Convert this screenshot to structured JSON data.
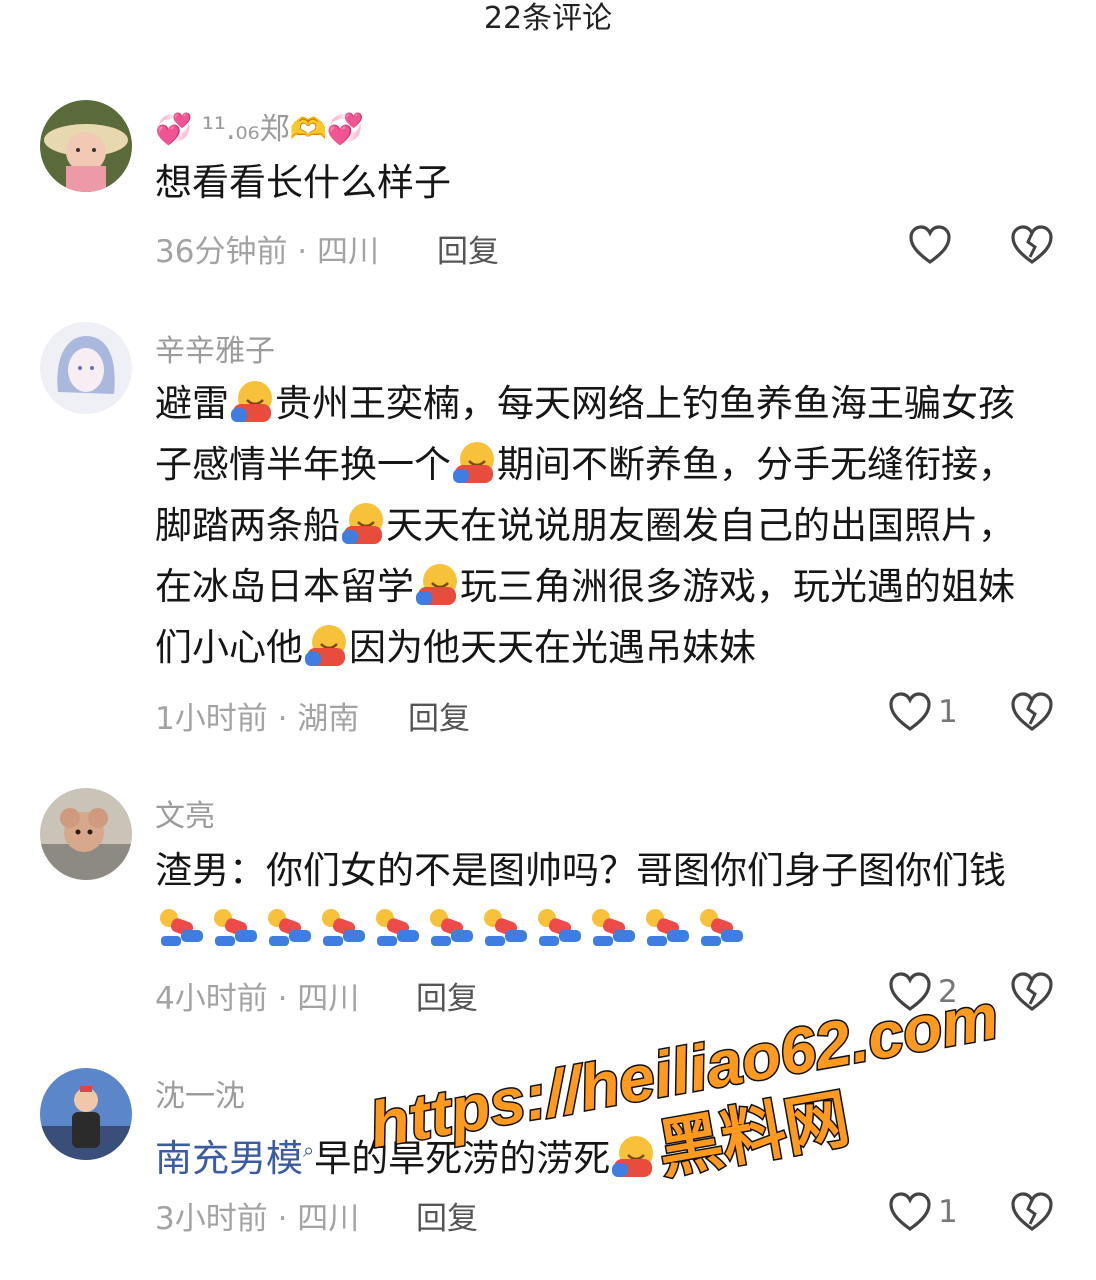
{
  "header": {
    "title": "22条评论"
  },
  "comments": [
    {
      "author": "💞 ¹¹.₀₆郑🫶💞",
      "text": "想看看长什么样子",
      "time_location": "36分钟前 · 四川",
      "reply_label": "回复",
      "like_count": ""
    },
    {
      "author": "辛辛雅子",
      "segments": [
        "避雷",
        "贵州王奕楠，每天网络上钓鱼养鱼海王骗女孩子感情半年换一个",
        "期间不断养鱼，分手无缝衔接，脚踏两条船",
        "天天在说说朋友圈发自己的出国照片，在冰岛日本留学",
        "玩三角洲很多游戏，玩光遇的姐妹们小心他",
        "因为他天天在光遇吊妹妹"
      ],
      "time_location": "1小时前 · 湖南",
      "reply_label": "回复",
      "like_count": "1"
    },
    {
      "author": "文亮",
      "text": "渣男：你们女的不是图帅吗？哥图你们身子图你们钱",
      "time_location": "4小时前 · 四川",
      "reply_label": "回复",
      "like_count": "2"
    },
    {
      "author": "沈一沈",
      "mention": "南充男模",
      "text": "早的旱死涝的涝死",
      "time_location": "3小时前 · 四川",
      "reply_label": "回复",
      "like_count": "1"
    }
  ],
  "icons": {
    "like": "heart-outline-icon",
    "dislike": "broken-heart-icon",
    "emoji_hug": "hugging-face-emoji",
    "emoji_kneel": "kneeling-person-emoji"
  },
  "watermark": {
    "url": "https://heiliao62.com",
    "name": "黑料网",
    "color": "#ff9a1f"
  }
}
